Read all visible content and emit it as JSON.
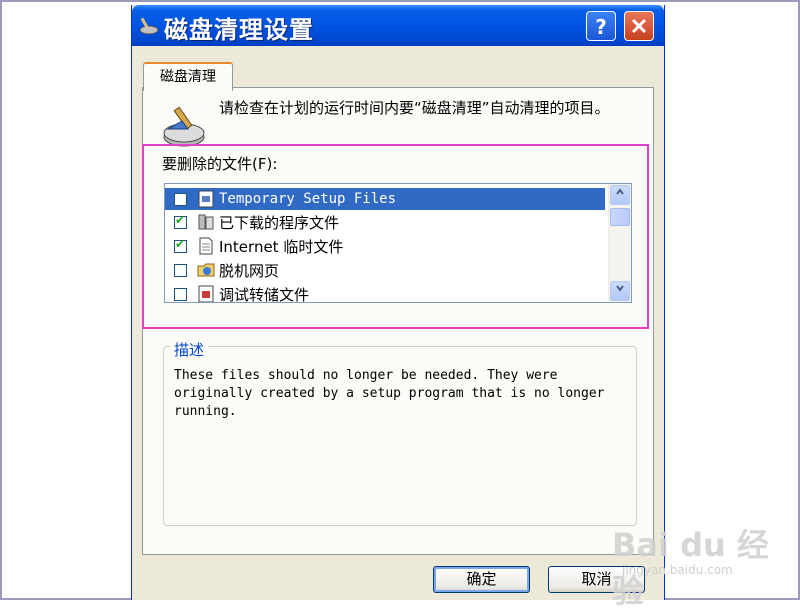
{
  "window": {
    "title": "磁盘清理设置"
  },
  "tab": {
    "label": "磁盘清理"
  },
  "intro": "请检查在计划的运行时间内要“磁盘清理”自动清理的项目。",
  "files": {
    "label": "要删除的文件(F):",
    "items": [
      {
        "name": "Temporary Setup Files",
        "checked": false,
        "selected": true,
        "icon": "setup-file-icon"
      },
      {
        "name": "已下载的程序文件",
        "checked": true,
        "selected": false,
        "icon": "folder-icon"
      },
      {
        "name": "Internet 临时文件",
        "checked": true,
        "selected": false,
        "icon": "document-icon"
      },
      {
        "name": "脱机网页",
        "checked": false,
        "selected": false,
        "icon": "offline-web-icon"
      },
      {
        "name": "调试转储文件",
        "checked": false,
        "selected": false,
        "icon": "dump-file-icon"
      }
    ]
  },
  "description": {
    "title": "描述",
    "text": "These files should no longer be needed. They were originally created by a setup program that is no longer running."
  },
  "buttons": {
    "ok": "确定",
    "cancel": "取消"
  },
  "watermark": {
    "brand": "Bai du 经验",
    "url": "jingyan.baidu.com"
  },
  "colors": {
    "title_bar": "#0054e3",
    "selection": "#316ac5",
    "highlight_box": "#e040c8",
    "group_title": "#0046d5"
  }
}
